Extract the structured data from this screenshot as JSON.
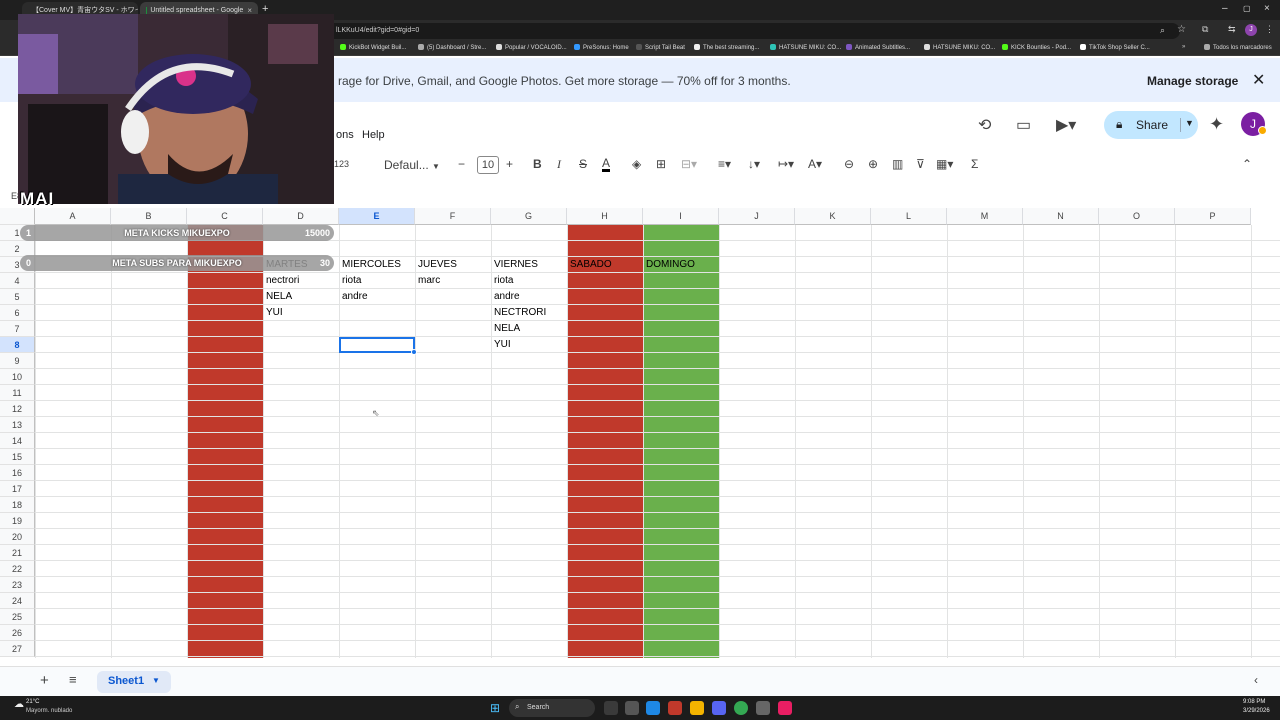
{
  "browser": {
    "tabs": [
      {
        "label": "【Cover MV】青宙ウタSV - ホワイ"
      },
      {
        "label": "Untitled spreadsheet - Google"
      }
    ],
    "url": "lLKKuU4/edit?gid=0#gid=0",
    "bookmarks": [
      "KickBot Widget Buil...",
      "(5) Dashboard / Stre...",
      "Popular / VOCALOID...",
      "PreSonus: Home",
      "Script Tail Beat",
      "The best streaming...",
      "HATSUNE MIKU: CO...",
      "Animated Subtitles...",
      "HATSUNE MIKU: CO...",
      "KICK Bounties - Pod...",
      "TikTok Shop Seller C..."
    ],
    "bookmarks_folder": "Todos los marcadores"
  },
  "banner": {
    "message": "rage for Drive, Gmail, and Google Photos. Get more storage — 70% off for 3 months.",
    "manage_label": "Manage storage"
  },
  "menu": {
    "partial": "ons",
    "help": "Help"
  },
  "header": {
    "share_label": "Share",
    "avatar_letter": "J"
  },
  "toolbar": {
    "format_123": "123",
    "font": "Defaul...",
    "font_size": "10"
  },
  "namebox": "E8",
  "grid": {
    "columns": [
      "A",
      "B",
      "C",
      "D",
      "E",
      "F",
      "G",
      "H",
      "I",
      "J",
      "K",
      "L",
      "M",
      "N",
      "O",
      "P"
    ],
    "rows": [
      "1",
      "2",
      "3",
      "4",
      "5",
      "6",
      "7",
      "8",
      "9",
      "10",
      "11",
      "12",
      "13",
      "14",
      "15",
      "16",
      "17",
      "18",
      "19",
      "20",
      "21",
      "22",
      "23",
      "24",
      "25",
      "26",
      "27"
    ],
    "selected_column": "E",
    "selected_row": "8",
    "cells": {
      "D3": "MARTES",
      "E3": "MIERCOLES",
      "F3": "JUEVES",
      "G3": "VIERNES",
      "H3": "SABADO",
      "I3": "DOMINGO",
      "D4": "nectrori",
      "E4": "riota",
      "F4": "marc",
      "G4": "riota",
      "D5": "NELA",
      "E5": "andre",
      "G5": "andre",
      "D6": "YUI",
      "G6": "NECTRORI",
      "G7": "NELA",
      "G8": "YUI"
    },
    "column_fills": {
      "C": "#c0392b",
      "H": "#c0392b",
      "I": "#6ab04c"
    }
  },
  "overlay": {
    "kicks": {
      "current": "1",
      "title": "META KICKS MIKUEXPO",
      "target": "15000"
    },
    "subs": {
      "current": "0",
      "title": "META SUBS PARA MIKUEXPO",
      "target": "30"
    },
    "cam_tag": "MAI"
  },
  "sheets": {
    "active": "Sheet1"
  },
  "taskbar": {
    "weather_temp": "21°C",
    "weather_desc": "Mayorm. nublado",
    "search": "Search",
    "time": "9:08 PM",
    "date": "3/29/2026"
  }
}
